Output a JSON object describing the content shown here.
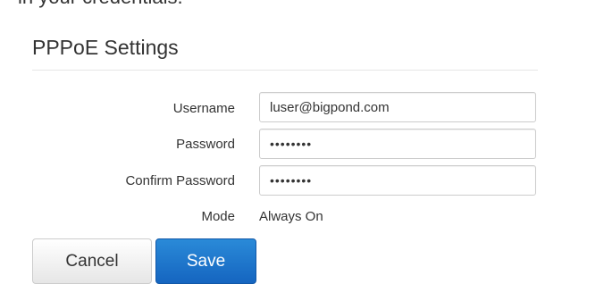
{
  "intro": {
    "text": "in your credentials."
  },
  "section": {
    "title": "PPPoE Settings"
  },
  "form": {
    "username": {
      "label": "Username",
      "value": "luser@bigpond.com"
    },
    "password": {
      "label": "Password",
      "value": "••••••••"
    },
    "confirm_password": {
      "label": "Confirm Password",
      "value": "••••••••"
    },
    "mode": {
      "label": "Mode",
      "value": "Always On"
    }
  },
  "actions": {
    "cancel_label": "Cancel",
    "save_label": "Save"
  },
  "colors": {
    "save_button": "#1565c0",
    "text": "#333333",
    "input_border": "#cccccc"
  }
}
